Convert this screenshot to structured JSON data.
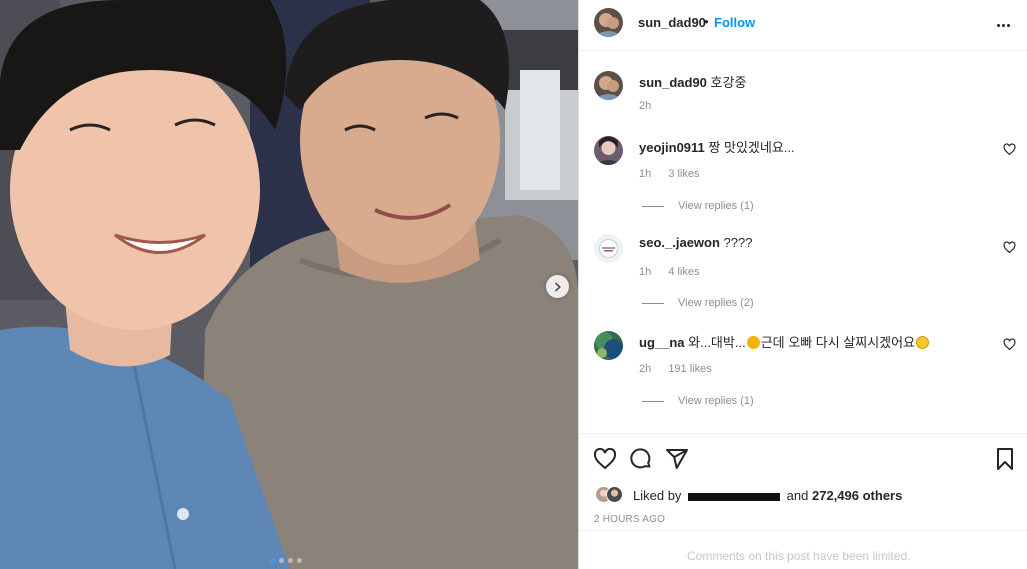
{
  "post": {
    "username": "sun_dad90",
    "separator": "•",
    "follow_label": "Follow",
    "caption": {
      "username": "sun_dad90",
      "text": "호강중",
      "time": "2h"
    }
  },
  "comments": [
    {
      "username": "yeojin0911",
      "text": "짱 맛있겠네요...",
      "time": "1h",
      "likes": "3 likes",
      "replies": "View replies (1)"
    },
    {
      "username": "seo._.jaewon",
      "text": "????",
      "time": "1h",
      "likes": "4 likes",
      "replies": "View replies (2)"
    },
    {
      "username": "ug__na",
      "text": "와...대박...",
      "text2": "근데 오빠 다시 살찌시겠어요",
      "time": "2h",
      "likes": "191 likes",
      "replies": "View replies (1)"
    }
  ],
  "likes": {
    "prefix": "Liked by",
    "and": "and",
    "count": "272,496 others"
  },
  "timestamp": "2 HOURS AGO",
  "footer_notice": "Comments on this post have been limited.",
  "carousel": {
    "slides": 4,
    "active_index": 0
  },
  "colors": {
    "accent": "#0095f6",
    "secondary_text": "#8e8e8e",
    "active_dot": "#3b9cf5"
  }
}
